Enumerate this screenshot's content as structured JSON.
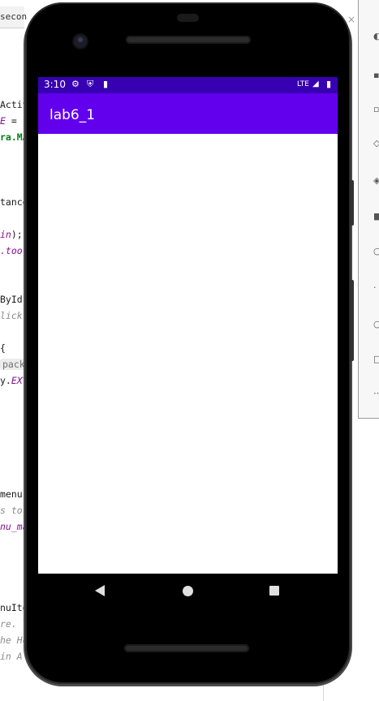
{
  "ide": {
    "tab_label": "secon",
    "code_lines": [
      {
        "parts": [
          {
            "t": "Activ",
            "c": ""
          }
        ]
      },
      {
        "parts": [
          {
            "t": "E",
            "c": "kw-purple"
          },
          {
            "t": " =",
            "c": ""
          }
        ]
      },
      {
        "parts": [
          {
            "t": "ra.MA",
            "c": "kw-green"
          }
        ]
      },
      {
        "parts": [
          {
            "t": "tance",
            "c": ""
          }
        ]
      },
      {
        "parts": [
          {
            "t": "in",
            "c": "kw-purple"
          },
          {
            "t": ");",
            "c": ""
          }
        ]
      },
      {
        "parts": [
          {
            "t": ".tool",
            "c": "kw-purple"
          }
        ]
      },
      {
        "parts": [
          {
            "t": "ById(",
            "c": ""
          }
        ]
      },
      {
        "parts": [
          {
            "t": "lick",
            "c": "cm"
          }
        ]
      },
      {
        "parts": [
          {
            "t": "{",
            "c": ""
          }
        ]
      },
      {
        "parts": [
          {
            "t": "pack",
            "c": "hint"
          }
        ]
      },
      {
        "parts": [
          {
            "t": "y.",
            "c": ""
          },
          {
            "t": "EXT",
            "c": "kw-purple"
          }
        ]
      },
      {
        "parts": [
          {
            "t": " menu",
            "c": ""
          }
        ]
      },
      {
        "parts": [
          {
            "t": "s to",
            "c": "cm"
          }
        ]
      },
      {
        "parts": [
          {
            "t": "nu_ma",
            "c": "kw-purple"
          }
        ]
      },
      {
        "parts": [
          {
            "t": "nuIte",
            "c": ""
          }
        ]
      },
      {
        "parts": [
          {
            "t": "re. T",
            "c": "cm"
          }
        ]
      },
      {
        "parts": [
          {
            "t": "he Ho",
            "c": "cm"
          }
        ]
      },
      {
        "parts": [
          {
            "t": " in A",
            "c": "cm"
          }
        ]
      }
    ],
    "side_panel_close": "×"
  },
  "status_bar": {
    "time": "3:10",
    "network": "LTE"
  },
  "app_bar": {
    "title": "lab6_1"
  },
  "colors": {
    "status_bar": "#3700b3",
    "app_bar": "#6200ee"
  }
}
